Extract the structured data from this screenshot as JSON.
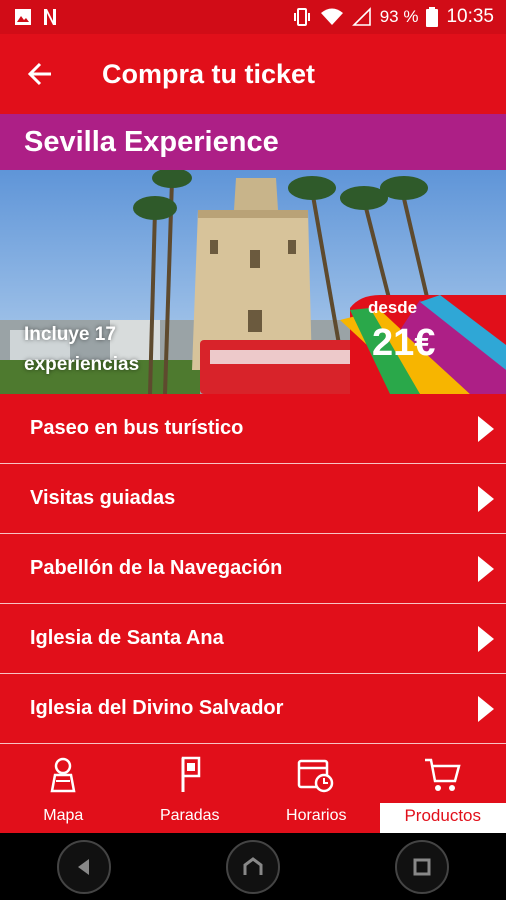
{
  "status_bar": {
    "battery": "93 %",
    "time": "10:35"
  },
  "app_bar": {
    "title": "Compra tu ticket"
  },
  "banner": {
    "title": "Sevilla Experience",
    "caption": "Incluye 17 experiencias",
    "price_from": "desde",
    "price": "21€"
  },
  "menu": [
    {
      "label": "Paseo en bus turístico"
    },
    {
      "label": "Visitas guiadas"
    },
    {
      "label": "Pabellón de la Navegación"
    },
    {
      "label": "Iglesia de Santa Ana"
    },
    {
      "label": "Iglesia del Divino Salvador"
    }
  ],
  "tabs": [
    {
      "label": "Mapa",
      "icon": "map-figure-icon"
    },
    {
      "label": "Paradas",
      "icon": "bus-stop-icon"
    },
    {
      "label": "Horarios",
      "icon": "calendar-clock-icon"
    },
    {
      "label": "Productos",
      "icon": "shopping-cart-icon",
      "active": true
    }
  ],
  "colors": {
    "primary": "#e10f1a",
    "banner": "#ad1f86"
  }
}
